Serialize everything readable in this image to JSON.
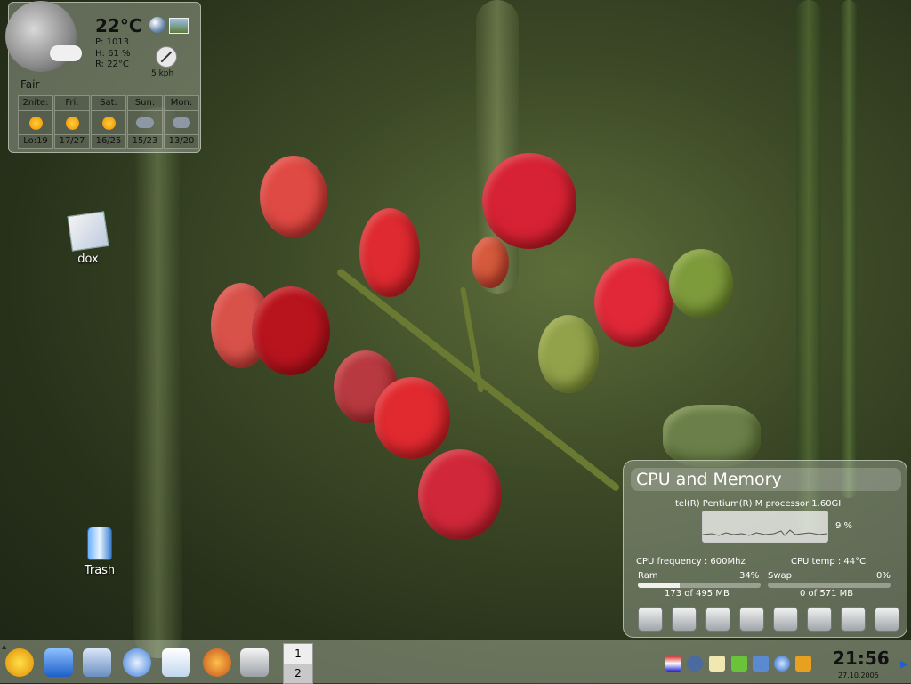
{
  "weather": {
    "temperature": "22°C",
    "pressure": "P: 1013",
    "humidity": "H: 61 %",
    "realfeel": "R: 22°C",
    "wind": "5 kph",
    "condition": "Fair",
    "forecast": [
      {
        "day": "2nite:",
        "temps": "Lo:19",
        "icon": "partly-cloudy-icon"
      },
      {
        "day": "Fri:",
        "temps": "17/27",
        "icon": "sun-icon"
      },
      {
        "day": "Sat:",
        "temps": "16/25",
        "icon": "sun-icon"
      },
      {
        "day": "Sun:",
        "temps": "15/23",
        "icon": "rain-icon"
      },
      {
        "day": "Mon:",
        "temps": "13/20",
        "icon": "rain-icon"
      }
    ]
  },
  "desktop": {
    "dox_label": "dox",
    "trash_label": "Trash"
  },
  "cpu": {
    "title": "CPU and Memory",
    "processor": "tel(R) Pentium(R) M processor 1.60GI",
    "load": "9 %",
    "frequency": "CPU frequency : 600Mhz",
    "temp": "CPU temp : 44°C",
    "ram_label": "Ram",
    "ram_pct": "34%",
    "ram_fill": 34,
    "swap_label": "Swap",
    "swap_pct": "0%",
    "swap_fill": 0,
    "ram_used": "173 of 495 MB",
    "swap_used": "0 of 571 MB"
  },
  "taskbar": {
    "pager_desktops": [
      "1",
      "2"
    ],
    "clock": "21:56",
    "date": "27.10.2005"
  },
  "colors": {
    "accent_red": "#c8242c",
    "berry_green": "#7e9b3c"
  }
}
